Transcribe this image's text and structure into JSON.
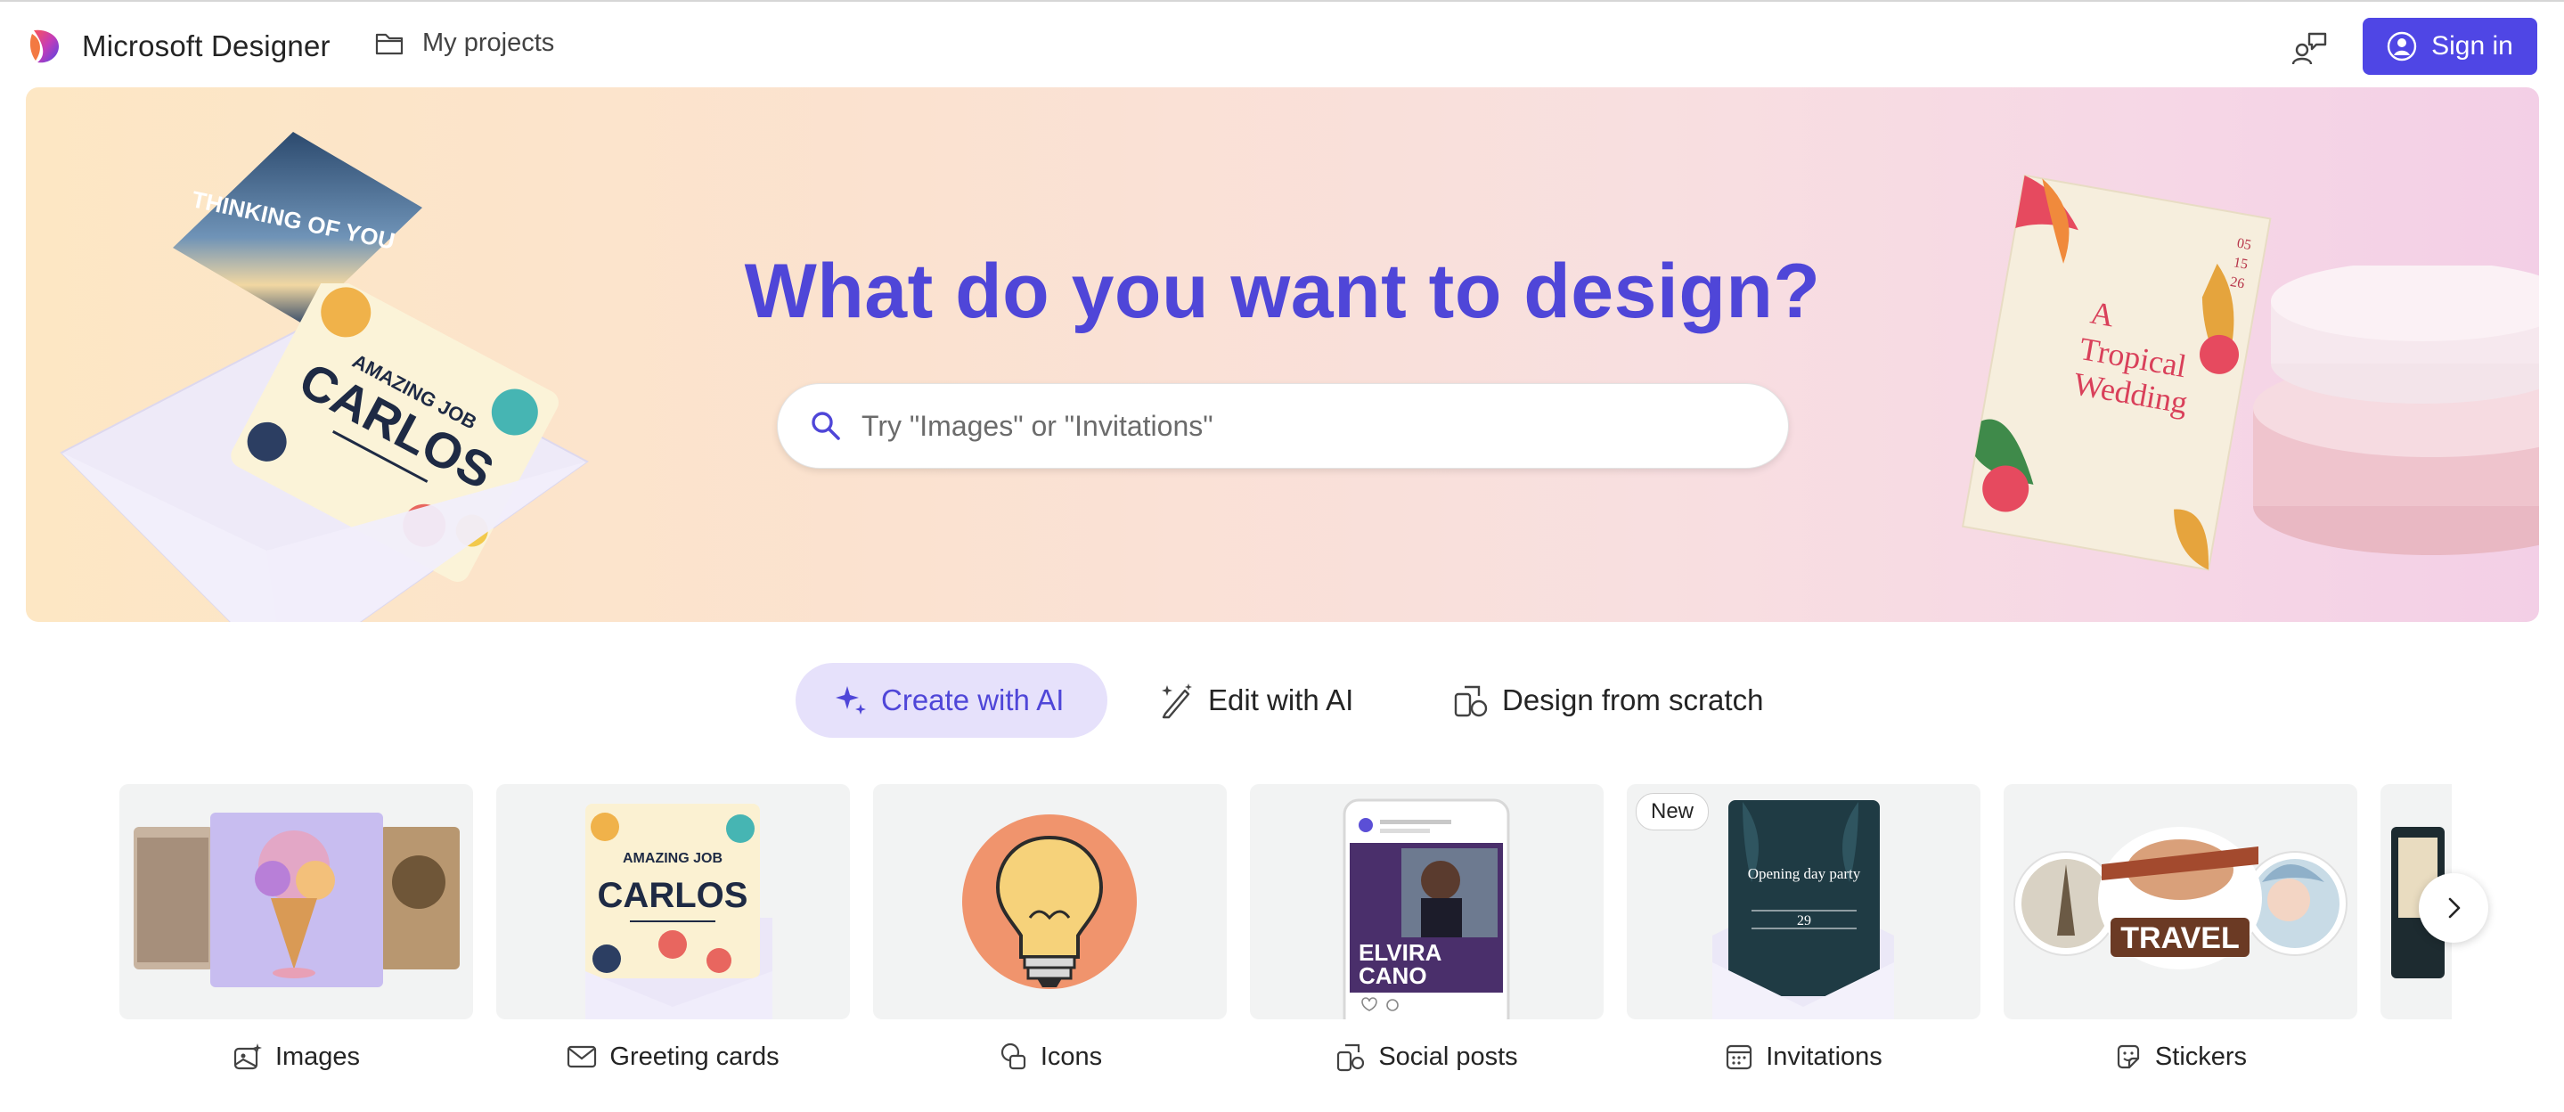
{
  "header": {
    "brand_name": "Microsoft Designer",
    "projects_label": "My projects",
    "signin_label": "Sign in"
  },
  "hero": {
    "title": "What do you want to design?",
    "search_placeholder": "Try \"Images\" or \"Invitations\"",
    "search_value": "",
    "art": {
      "thinking_text": "THINKING OF YOU",
      "card_top": "AMAZING JOB",
      "card_name": "CARLOS",
      "invite_date": [
        "05",
        "15",
        "26"
      ],
      "invite_title_1": "A",
      "invite_title_2": "Tropical",
      "invite_title_3": "Wedding"
    }
  },
  "modes": [
    {
      "label": "Create with AI",
      "active": true
    },
    {
      "label": "Edit with AI",
      "active": false
    },
    {
      "label": "Design from scratch",
      "active": false
    }
  ],
  "categories": [
    {
      "label": "Images",
      "icon": "image-sparkle-icon"
    },
    {
      "label": "Greeting cards",
      "icon": "mail-icon",
      "thumb_top": "AMAZING JOB",
      "thumb_name": "CARLOS"
    },
    {
      "label": "Icons",
      "icon": "shapes-icon"
    },
    {
      "label": "Social posts",
      "icon": "design-ideas-icon",
      "thumb_name_1": "ELVIRA",
      "thumb_name_2": "CANO"
    },
    {
      "label": "Invitations",
      "icon": "calendar-icon",
      "badge": "New",
      "thumb_title": "Opening day party",
      "thumb_day": "29"
    },
    {
      "label": "Stickers",
      "icon": "sticker-icon",
      "thumb_text": "TRAVEL"
    }
  ],
  "colors": {
    "accent": "#4f46e5",
    "title": "#4f46d8",
    "active_mode_bg": "#e6e1fb",
    "card_bg": "#f2f3f3"
  }
}
